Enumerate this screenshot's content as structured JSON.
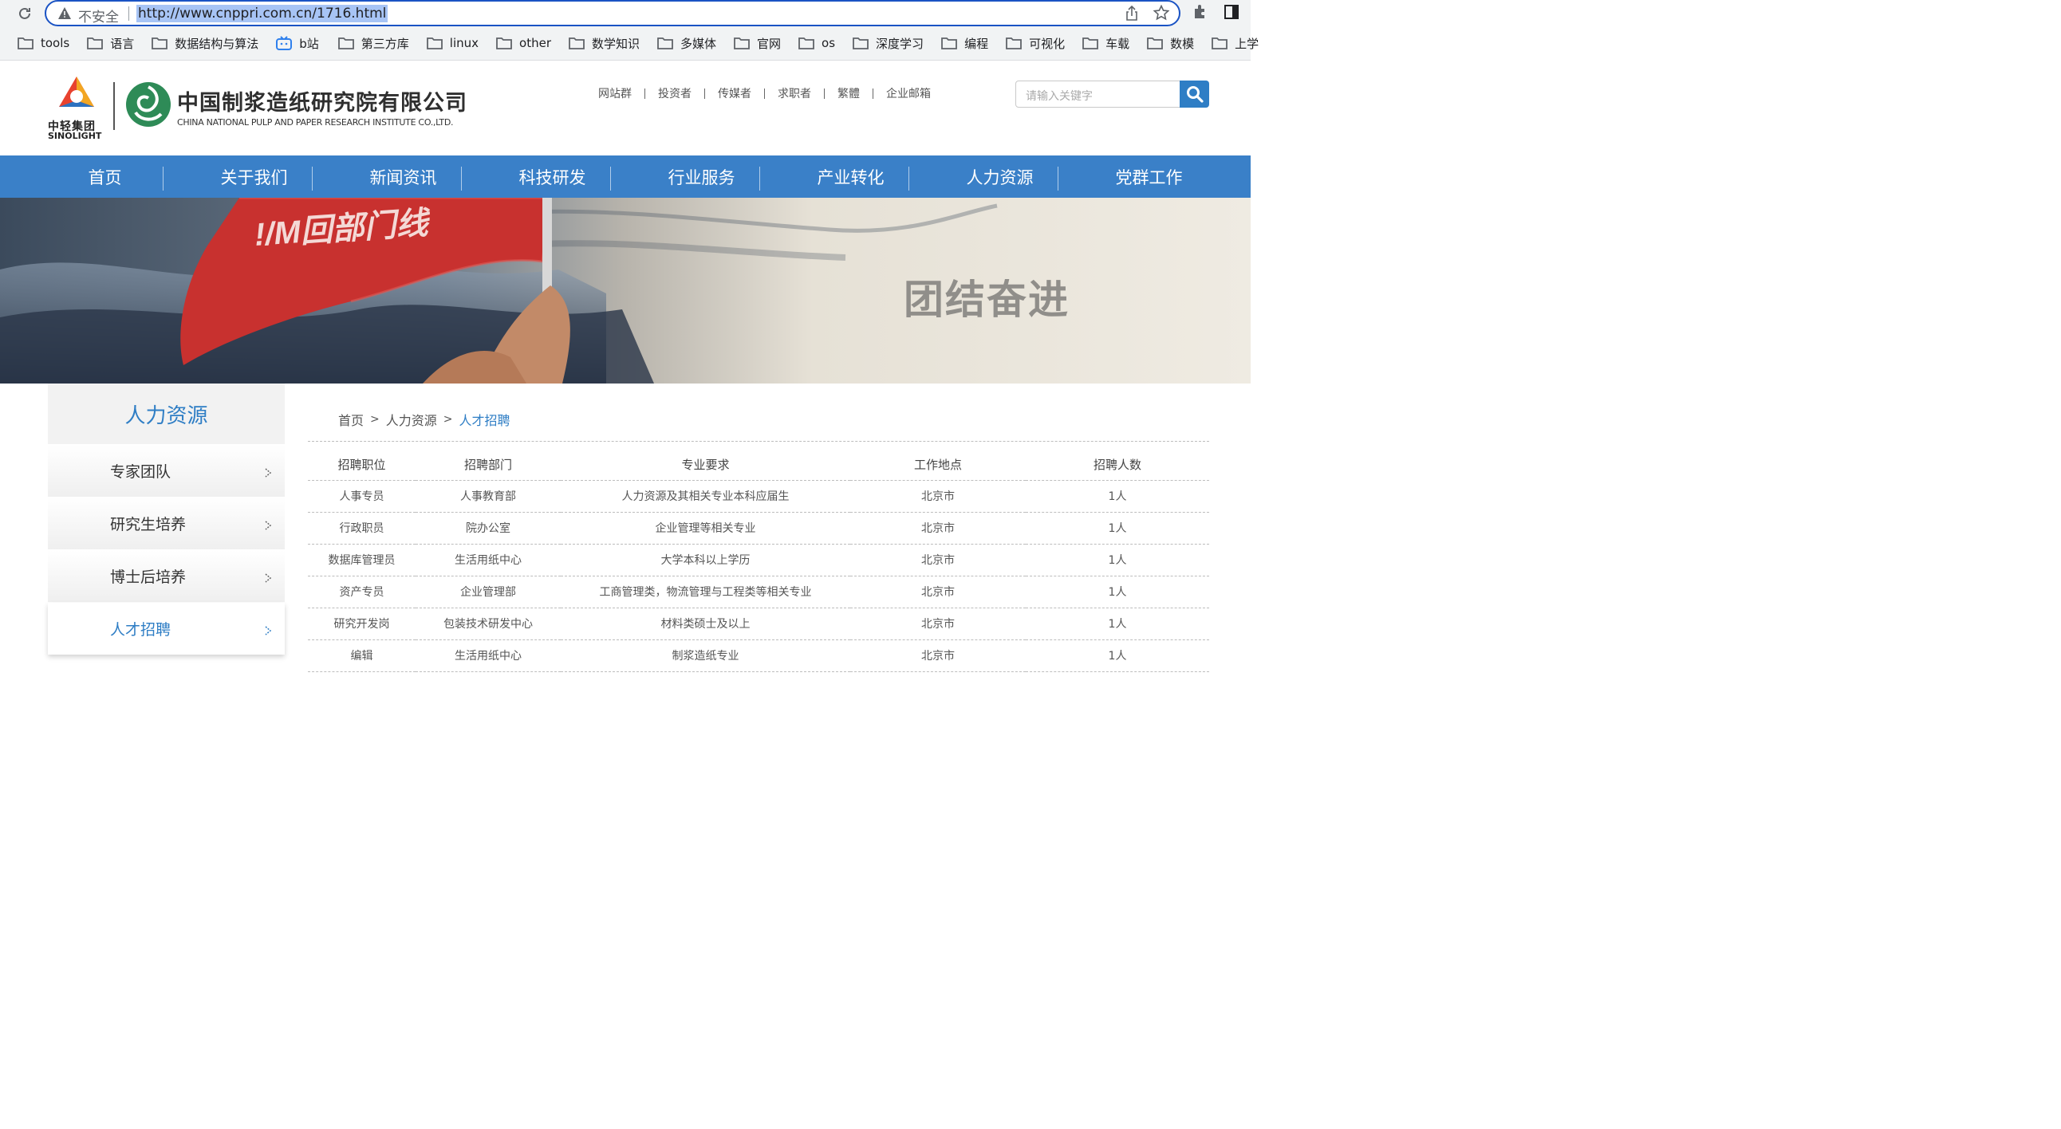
{
  "browser": {
    "insecure_label": "不安全",
    "url": "http://www.cnppri.com.cn/1716.html",
    "bookmarks": [
      "tools",
      "语言",
      "数据结构与算法",
      "b站",
      "第三方库",
      "linux",
      "other",
      "数学知识",
      "多媒体",
      "官网",
      "os",
      "深度学习",
      "编程",
      "可视化",
      "车载",
      "数模",
      "上学"
    ]
  },
  "header": {
    "sinolight_cn": "中轻集团",
    "sinolight_en": "SINOLIGHT",
    "company_cn": "中国制浆造纸研究院有限公司",
    "company_en": "CHINA NATIONAL PULP AND PAPER RESEARCH INSTITUTE CO.,LTD.",
    "top_links": [
      "网站群",
      "投资者",
      "传媒者",
      "求职者",
      "繁體",
      "企业邮箱"
    ],
    "search_placeholder": "请输入关键字"
  },
  "nav": [
    "首页",
    "关于我们",
    "新闻资讯",
    "科技研发",
    "行业服务",
    "产业转化",
    "人力资源",
    "党群工作"
  ],
  "banner": {
    "slogan": "团结奋进",
    "flag_text": "!/M回部门线"
  },
  "sidebar": {
    "title": "人力资源",
    "items": [
      "专家团队",
      "研究生培养",
      "博士后培养",
      "人才招聘"
    ],
    "active_index": 3
  },
  "breadcrumb": [
    "首页",
    "人力资源",
    "人才招聘"
  ],
  "jobs_table": {
    "headers": [
      "招聘职位",
      "招聘部门",
      "专业要求",
      "工作地点",
      "招聘人数"
    ],
    "rows": [
      [
        "人事专员",
        "人事教育部",
        "人力资源及其相关专业本科应届生",
        "北京市",
        "1人"
      ],
      [
        "行政职员",
        "院办公室",
        "企业管理等相关专业",
        "北京市",
        "1人"
      ],
      [
        "数据库管理员",
        "生活用纸中心",
        "大学本科以上学历",
        "北京市",
        "1人"
      ],
      [
        "资产专员",
        "企业管理部",
        "工商管理类，物流管理与工程类等相关专业",
        "北京市",
        "1人"
      ],
      [
        "研究开发岗",
        "包装技术研发中心",
        "材料类硕士及以上",
        "北京市",
        "1人"
      ],
      [
        "编辑",
        "生活用纸中心",
        "制浆造纸专业",
        "北京市",
        "1人"
      ]
    ]
  }
}
